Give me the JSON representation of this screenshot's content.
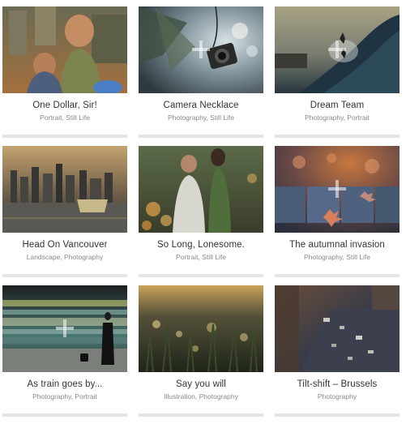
{
  "items": [
    {
      "title": "One Dollar, Sir!",
      "categories": "Portrait, Still Life",
      "image": "photo-children-temple"
    },
    {
      "title": "Camera Necklace",
      "categories": "Photography, Still Life",
      "image": "photo-camera-necklace"
    },
    {
      "title": "Dream Team",
      "categories": "Photography, Portrait",
      "image": "photo-surfers-wave"
    },
    {
      "title": "Head On Vancouver",
      "categories": "Landscape, Photography",
      "image": "photo-vancouver-skyline"
    },
    {
      "title": "So Long, Lonesome.",
      "categories": "Portrait, Still Life",
      "image": "photo-couple-bokeh"
    },
    {
      "title": "The autumnal invasion",
      "categories": "Photography, Still Life",
      "image": "photo-autumn-leaves"
    },
    {
      "title": "As train goes by...",
      "categories": "Photography, Portrait",
      "image": "photo-train-motion"
    },
    {
      "title": "Say you will",
      "categories": "Illustration, Photography",
      "image": "photo-grass-bokeh"
    },
    {
      "title": "Tilt-shift – Brussels",
      "categories": "Photography",
      "image": "photo-tiltshift-city"
    }
  ]
}
